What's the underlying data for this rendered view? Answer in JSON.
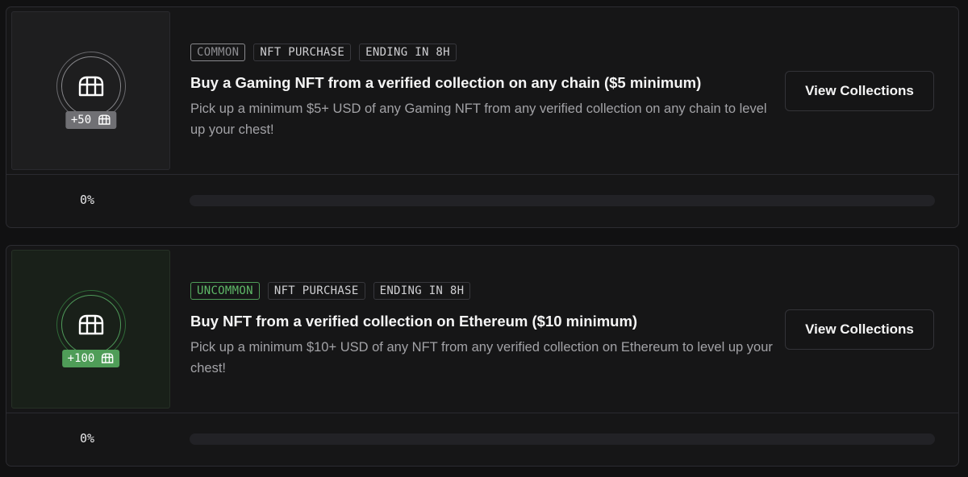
{
  "quests": [
    {
      "rarity": "COMMON",
      "category": "NFT PURCHASE",
      "ending": "ENDING IN 8H",
      "title": "Buy a Gaming NFT from a verified collection on any chain ($5 minimum)",
      "description": "Pick up a minimum $5+ USD of any Gaming NFT from any verified collection on any chain to level up your chest!",
      "button_label": "View Collections",
      "reward": "+50",
      "reward_icon": "chest-icon",
      "progress_label": "0%",
      "progress": 0,
      "accent_color": "#8a8a8e"
    },
    {
      "rarity": "UNCOMMON",
      "category": "NFT PURCHASE",
      "ending": "ENDING IN 8H",
      "title": "Buy NFT from a verified collection on Ethereum ($10 minimum)",
      "description": "Pick up a minimum $10+ USD of any NFT from any verified collection on Ethereum to level up your chest!",
      "button_label": "View Collections",
      "reward": "+100",
      "reward_icon": "chest-icon",
      "progress_label": "0%",
      "progress": 0,
      "accent_color": "#4f9d58"
    }
  ]
}
